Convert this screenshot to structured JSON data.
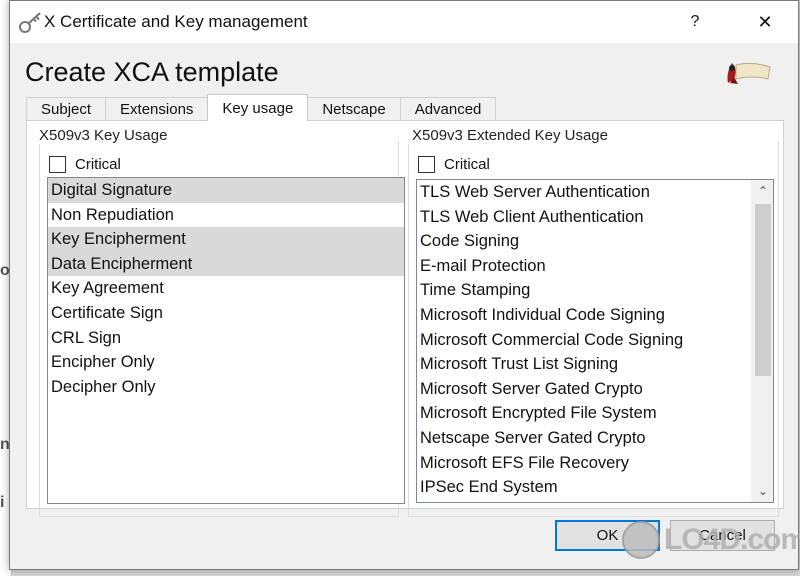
{
  "background_window": {
    "chars": [
      "o",
      "n",
      "i"
    ]
  },
  "titlebar": {
    "title": "X Certificate and Key management",
    "help": "?",
    "close": "✕"
  },
  "heading": "Create XCA template",
  "tabs": [
    {
      "label": "Subject",
      "active": false
    },
    {
      "label": "Extensions",
      "active": false
    },
    {
      "label": "Key usage",
      "active": true
    },
    {
      "label": "Netscape",
      "active": false
    },
    {
      "label": "Advanced",
      "active": false
    }
  ],
  "key_usage": {
    "title": "X509v3 Key Usage",
    "critical_label": "Critical",
    "critical_checked": false,
    "items": [
      {
        "label": "Digital Signature",
        "selected": true
      },
      {
        "label": "Non Repudiation",
        "selected": false
      },
      {
        "label": "Key Encipherment",
        "selected": true
      },
      {
        "label": "Data Encipherment",
        "selected": true
      },
      {
        "label": "Key Agreement",
        "selected": false
      },
      {
        "label": "Certificate Sign",
        "selected": false
      },
      {
        "label": "CRL Sign",
        "selected": false
      },
      {
        "label": "Encipher Only",
        "selected": false
      },
      {
        "label": "Decipher Only",
        "selected": false
      }
    ]
  },
  "extended_key_usage": {
    "title": "X509v3 Extended Key Usage",
    "critical_label": "Critical",
    "critical_checked": false,
    "items": [
      "TLS Web Server Authentication",
      "TLS Web Client Authentication",
      "Code Signing",
      "E-mail Protection",
      "Time Stamping",
      "Microsoft Individual Code Signing",
      "Microsoft Commercial Code Signing",
      "Microsoft Trust List Signing",
      "Microsoft Server Gated Crypto",
      "Microsoft Encrypted File System",
      "Netscape Server Gated Crypto",
      "Microsoft EFS File Recovery",
      "IPSec End System"
    ],
    "scroll_up": "⌃",
    "scroll_down": "⌄"
  },
  "buttons": {
    "ok": "OK",
    "cancel": "Cancel"
  },
  "watermark": {
    "text": "LO4D.com"
  },
  "colors": {
    "accent": "#0078d7",
    "selection": "#d9d9d9",
    "dialog_bg": "#f0f0f0"
  },
  "icons": {
    "app": "key-icon",
    "logo": "xca-scroll-logo-icon"
  }
}
